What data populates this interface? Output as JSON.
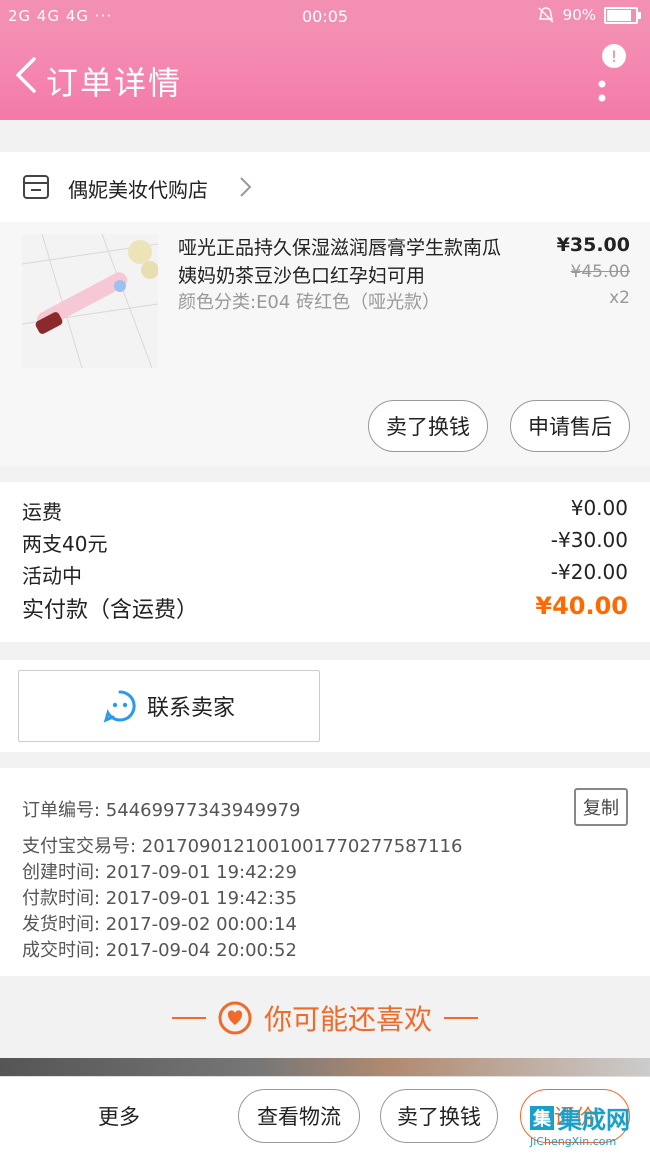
{
  "status_bar": {
    "left": "2G 4G 4G ···",
    "time": "00:05",
    "battery": "90%"
  },
  "header": {
    "title": "订单详情",
    "more_badge": "!"
  },
  "shop": {
    "name": "偶妮美妆代购店"
  },
  "product": {
    "title": "哑光正品持久保湿滋润唇膏学生款南瓜姨妈奶茶豆沙色口红孕妇可用",
    "spec": "颜色分类:E04 砖红色（哑光款）",
    "price": "¥35.00",
    "original_price": "¥45.00",
    "quantity": "x2",
    "button_resell": "卖了换钱",
    "button_aftersale": "申请售后"
  },
  "fees": {
    "shipping_label": "运费",
    "shipping_value": "¥0.00",
    "promo_label": "两支40元",
    "promo_value": "-¥30.00",
    "activity_label": "活动中",
    "activity_value": "-¥20.00",
    "total_label": "实付款（含运费）",
    "total_value": "¥40.00"
  },
  "contact": {
    "label": "联系卖家"
  },
  "order_info": {
    "order_no": "订单编号: 54469977343949979",
    "alipay_no": "支付宝交易号: 2017090121001001770277587116",
    "created": "创建时间: 2017-09-01 19:42:29",
    "paid": "付款时间: 2017-09-01 19:42:35",
    "shipped": "发货时间: 2017-09-02 00:00:14",
    "completed": "成交时间: 2017-09-04 20:00:52",
    "copy_label": "复制"
  },
  "recommend": {
    "title": "你可能还喜欢"
  },
  "bottom_bar": {
    "more": "更多",
    "view_logistics": "查看物流",
    "resell": "卖了换钱",
    "review": "评价"
  },
  "watermark": {
    "brand": "集成网",
    "url": "JiChengXin.com"
  },
  "colors": {
    "header_pink": "#f48fb4",
    "accent_orange": "#ff6a00",
    "contact_blue": "#2a9be8"
  }
}
